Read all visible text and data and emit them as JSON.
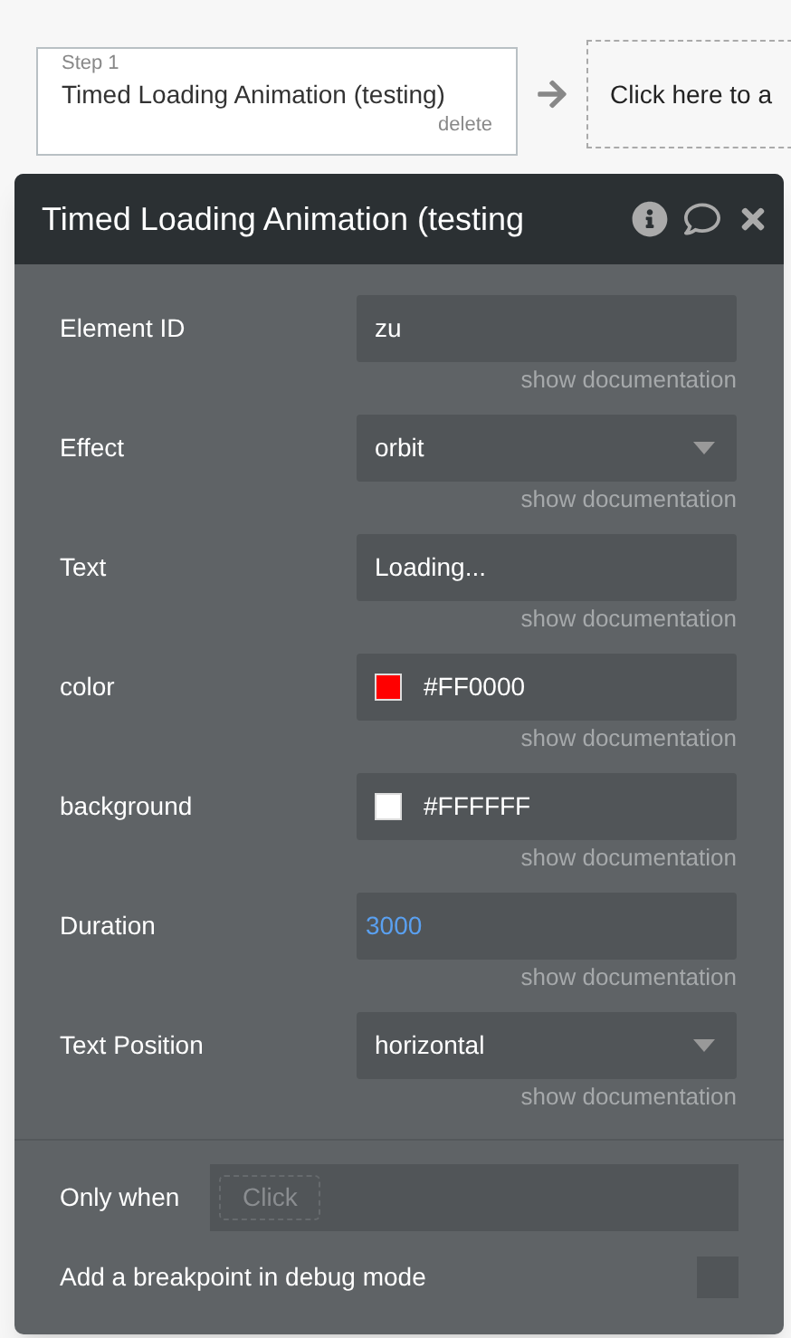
{
  "step": {
    "label": "Step 1",
    "title": "Timed Loading Animation (testing)",
    "delete": "delete"
  },
  "add_action": {
    "text": "Click here to a"
  },
  "panel": {
    "title": "Timed Loading Animation (testing",
    "fields": [
      {
        "kind": "text",
        "label": "Element ID",
        "value": "zu",
        "doc": "show documentation"
      },
      {
        "kind": "dropdown",
        "label": "Effect",
        "value": "orbit",
        "doc": "show documentation"
      },
      {
        "kind": "text",
        "label": "Text",
        "value": "Loading...",
        "doc": "show documentation"
      },
      {
        "kind": "color",
        "label": "color",
        "value": "#FF0000",
        "color": "#ff0000",
        "doc": "show documentation"
      },
      {
        "kind": "color",
        "label": "background",
        "value": "#FFFFFF",
        "color": "#ffffff",
        "doc": "show documentation"
      },
      {
        "kind": "number",
        "label": "Duration",
        "value": "3000",
        "doc": "show documentation"
      },
      {
        "kind": "dropdown",
        "label": "Text Position",
        "value": "horizontal",
        "doc": "show documentation"
      }
    ],
    "only_when": {
      "label": "Only when",
      "placeholder": "Click"
    },
    "breakpoint": {
      "label": "Add a breakpoint in debug mode",
      "checked": false
    }
  }
}
